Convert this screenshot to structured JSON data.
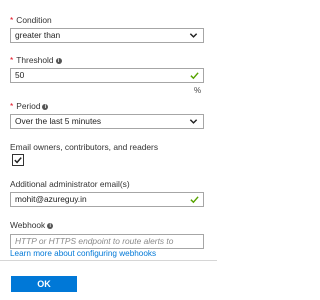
{
  "condition": {
    "label": "Condition",
    "value": "greater than"
  },
  "threshold": {
    "label": "Threshold",
    "value": "50",
    "unit": "%"
  },
  "period": {
    "label": "Period",
    "value": "Over the last 5 minutes"
  },
  "email_owners": {
    "label": "Email owners, contributors, and readers",
    "checked": true
  },
  "admin_email": {
    "label": "Additional administrator email(s)",
    "value": "mohit@azureguy.in"
  },
  "webhook": {
    "label": "Webhook",
    "placeholder": "HTTP or HTTPS endpoint to route alerts to",
    "learn_more": "Learn more about configuring webhooks"
  },
  "ok_button": {
    "label": "OK"
  },
  "colors": {
    "accent": "#0078d7",
    "required": "#e00b1c",
    "valid": "#57a300"
  },
  "icons": [
    "info-icon",
    "chevron-down-icon",
    "checkmark-icon",
    "checkbox-check-icon"
  ]
}
